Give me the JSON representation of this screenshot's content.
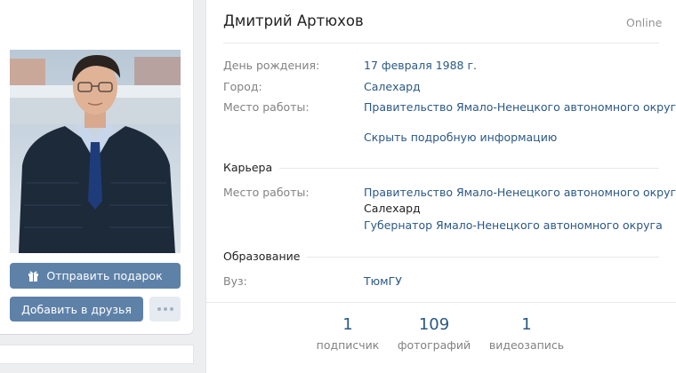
{
  "profile": {
    "name": "Дмитрий Артюхов",
    "status": "Online"
  },
  "actions": {
    "gift_label": "Отправить подарок",
    "add_friend_label": "Добавить в друзья",
    "more_icon": "more-icon"
  },
  "info": {
    "birthday_label": "День рождения:",
    "birthday_value": "17 февраля 1988 г.",
    "city_label": "Город:",
    "city_value": "Салехард",
    "work_label": "Место работы:",
    "work_value": "Правительство Ямало-Ненецкого автономного округа",
    "hide_details_link": "Скрыть подробную информацию"
  },
  "career": {
    "title": "Карьера",
    "work_label": "Место работы:",
    "work_value": "Правительство Ямало-Ненецкого автономного округа",
    "city": "Салехард",
    "position": "Губернатор Ямало-Ненецкого автономного округа"
  },
  "education": {
    "title": "Образование",
    "university_label": "Вуз:",
    "university_value": "ТюмГУ"
  },
  "counters": [
    {
      "num": "1",
      "label": "подписчик"
    },
    {
      "num": "109",
      "label": "фотографий"
    },
    {
      "num": "1",
      "label": "видеозапись"
    }
  ]
}
